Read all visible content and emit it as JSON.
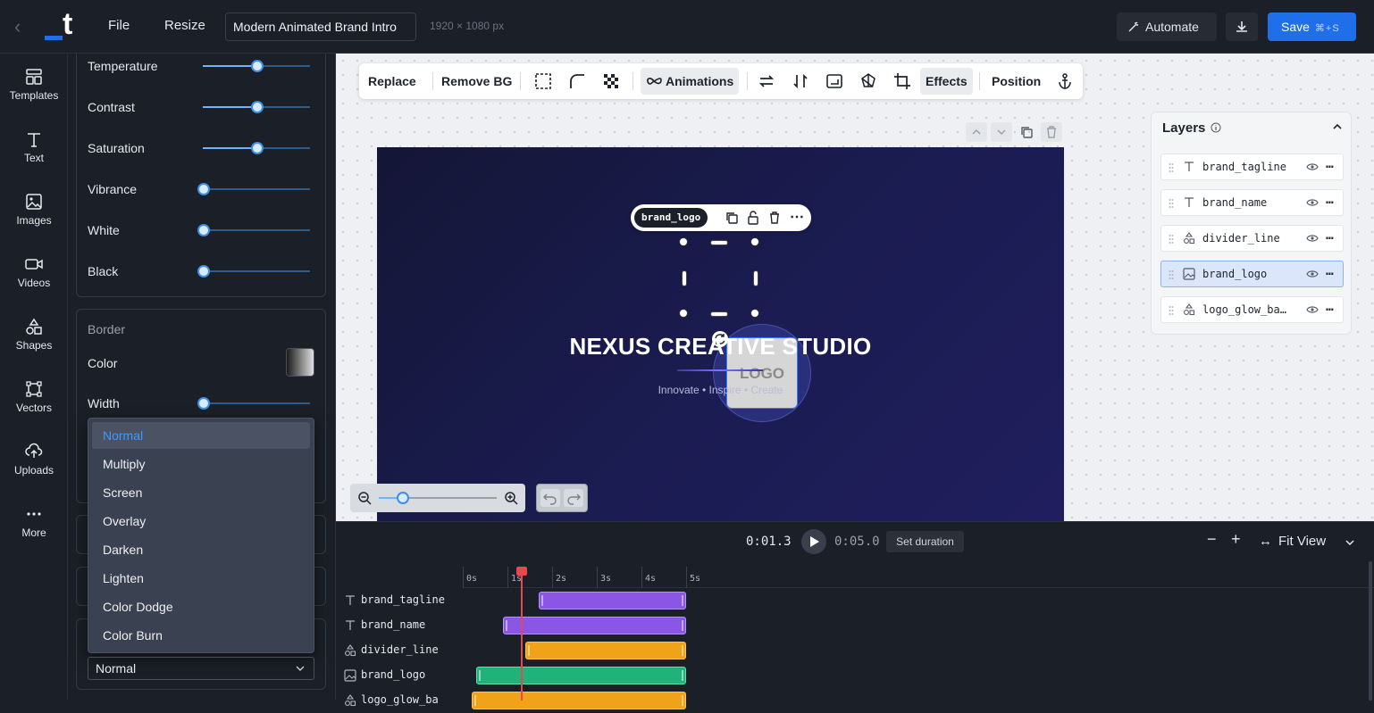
{
  "header": {
    "file_label": "File",
    "resize_label": "Resize",
    "project_title": "Modern Animated Brand Intro",
    "dimensions": "1920 × 1080 px",
    "automate_label": "Automate",
    "save_label": "Save",
    "save_shortcut": "⌘+S"
  },
  "rail": {
    "items": [
      {
        "label": "Templates",
        "icon": "templates-icon"
      },
      {
        "label": "Text",
        "icon": "text-icon"
      },
      {
        "label": "Images",
        "icon": "images-icon"
      },
      {
        "label": "Videos",
        "icon": "videos-icon"
      },
      {
        "label": "Shapes",
        "icon": "shapes-icon"
      },
      {
        "label": "Vectors",
        "icon": "vectors-icon"
      },
      {
        "label": "Uploads",
        "icon": "uploads-icon"
      },
      {
        "label": "More",
        "icon": "more-icon"
      }
    ]
  },
  "adjust": {
    "sliders": [
      {
        "label": "Temperature",
        "value": 0.5
      },
      {
        "label": "Contrast",
        "value": 0.5
      },
      {
        "label": "Saturation",
        "value": 0.5
      },
      {
        "label": "Vibrance",
        "value": 0
      },
      {
        "label": "White",
        "value": 0
      },
      {
        "label": "Black",
        "value": 0
      }
    ]
  },
  "border": {
    "title": "Border",
    "color_label": "Color",
    "width_label": "Width",
    "width_value": 0
  },
  "blend": {
    "options": [
      "Normal",
      "Multiply",
      "Screen",
      "Overlay",
      "Darken",
      "Lighten",
      "Color Dodge",
      "Color Burn"
    ],
    "selected": "Normal"
  },
  "toolbar": {
    "replace": "Replace",
    "remove_bg": "Remove BG",
    "animations": "Animations",
    "effects": "Effects",
    "position": "Position"
  },
  "artboard": {
    "selected_layer": "brand_logo",
    "logo_placeholder": "LOGO",
    "brand_name": "NEXUS CREATIVE STUDIO",
    "tagline": "Innovate • Inspire • Create",
    "zoom_level": 0.2
  },
  "layers": {
    "title": "Layers",
    "items": [
      {
        "name": "brand_tagline",
        "type": "text-icon",
        "active": false
      },
      {
        "name": "brand_name",
        "type": "text-icon",
        "active": false
      },
      {
        "name": "divider_line",
        "type": "shapes-icon",
        "active": false
      },
      {
        "name": "brand_logo",
        "type": "image-icon",
        "active": true
      },
      {
        "name": "logo_glow_ba…",
        "type": "shapes-icon",
        "active": false
      }
    ]
  },
  "timeline": {
    "current_time": "0:01.3",
    "total_time": "0:05.0",
    "set_duration_label": "Set duration",
    "fit_view_label": "Fit View",
    "ticks": [
      "0s",
      "1s",
      "2s",
      "3s",
      "4s",
      "5s"
    ],
    "tracks": [
      {
        "name": "brand_tagline",
        "start_s": 1.7,
        "end_s": 5.0,
        "color": "#8a56e6"
      },
      {
        "name": "brand_name",
        "start_s": 0.9,
        "end_s": 5.0,
        "color": "#8a56e6"
      },
      {
        "name": "divider_line",
        "start_s": 1.4,
        "end_s": 5.0,
        "color": "#f0a318"
      },
      {
        "name": "brand_logo",
        "start_s": 0.3,
        "end_s": 5.0,
        "color": "#1fb37a"
      },
      {
        "name": "logo_glow_ba",
        "start_s": 0.2,
        "end_s": 5.0,
        "color": "#f0a318"
      }
    ],
    "playhead_s": 1.3
  },
  "colors": {
    "accent": "#1f6feb",
    "bg": "#1b1f27",
    "selection": "#3d9bff"
  }
}
